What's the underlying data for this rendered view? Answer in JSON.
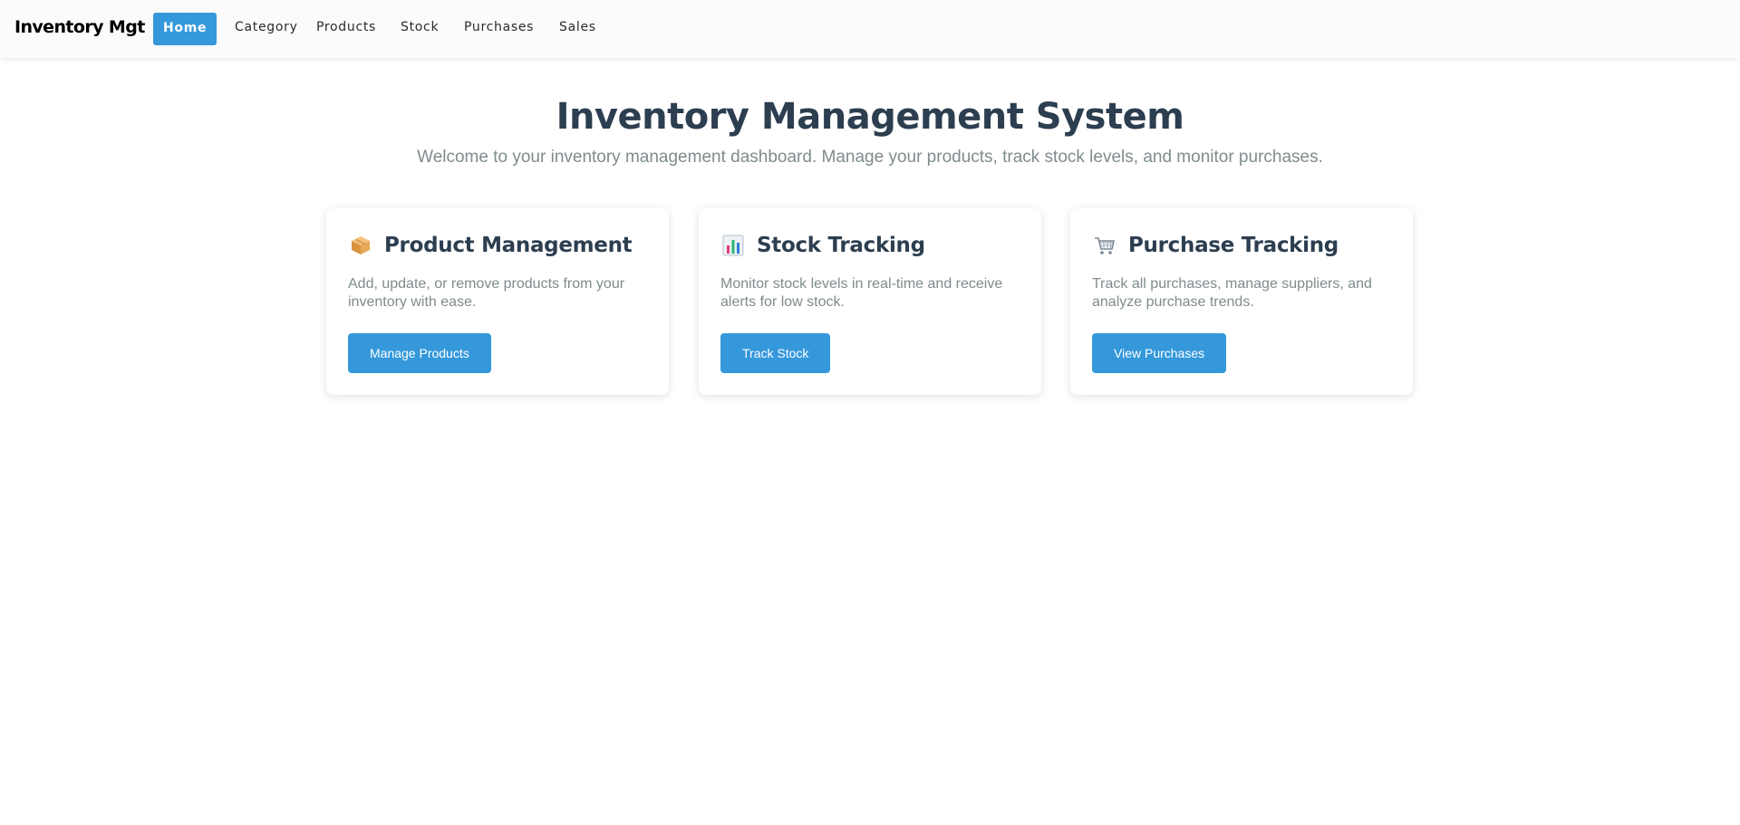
{
  "nav": {
    "brand": "Inventory Mgt",
    "items": [
      {
        "label": "Home",
        "active": true
      },
      {
        "label": "Category",
        "active": false
      },
      {
        "label": "Products",
        "active": false
      },
      {
        "label": "Stock",
        "active": false
      },
      {
        "label": "Purchases",
        "active": false
      },
      {
        "label": "Sales",
        "active": false
      }
    ]
  },
  "hero": {
    "title": "Inventory Management System",
    "subtitle": "Welcome to your inventory management dashboard. Manage your products, track stock levels, and monitor purchases."
  },
  "cards": [
    {
      "icon": "package-icon",
      "title": "Product Management",
      "description": "Add, update, or remove products from your inventory with ease.",
      "button": "Manage Products"
    },
    {
      "icon": "bar-chart-icon",
      "title": "Stock Tracking",
      "description": "Monitor stock levels in real-time and receive alerts for low stock.",
      "button": "Track Stock"
    },
    {
      "icon": "shopping-cart-icon",
      "title": "Purchase Tracking",
      "description": "Track all purchases, manage suppliers, and analyze purchase trends.",
      "button": "View Purchases"
    }
  ],
  "colors": {
    "accent": "#3498db",
    "heading": "#2c3e50",
    "muted": "#7f8c8d"
  }
}
